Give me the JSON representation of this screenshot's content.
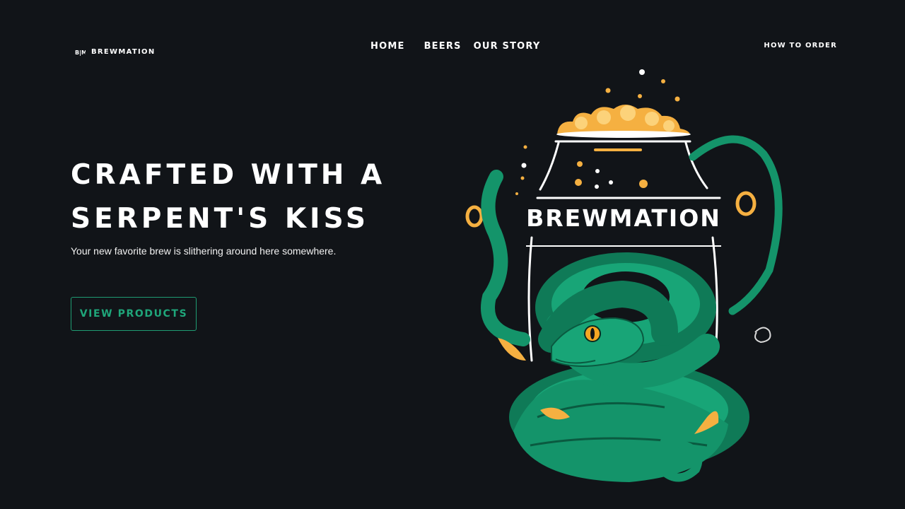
{
  "header": {
    "logo_mark": "B|M",
    "logo_text": "BREWMATION",
    "nav": {
      "home": "HOME",
      "beers": "BEERS",
      "our_story": "OUR STORY"
    },
    "order_link": "HOW TO ORDER"
  },
  "hero": {
    "title_line1": "CRAFTED WITH A",
    "title_line2": "SERPENT'S KISS",
    "subtitle": "Your new favorite brew is slithering around here somewhere.",
    "cta_label": "VIEW PRODUCTS",
    "illustration_text": "BREWMATION"
  },
  "colors": {
    "background": "#111418",
    "accent_green": "#1fa67a",
    "serpent_green": "#14946a",
    "foam_amber": "#f5b041"
  }
}
